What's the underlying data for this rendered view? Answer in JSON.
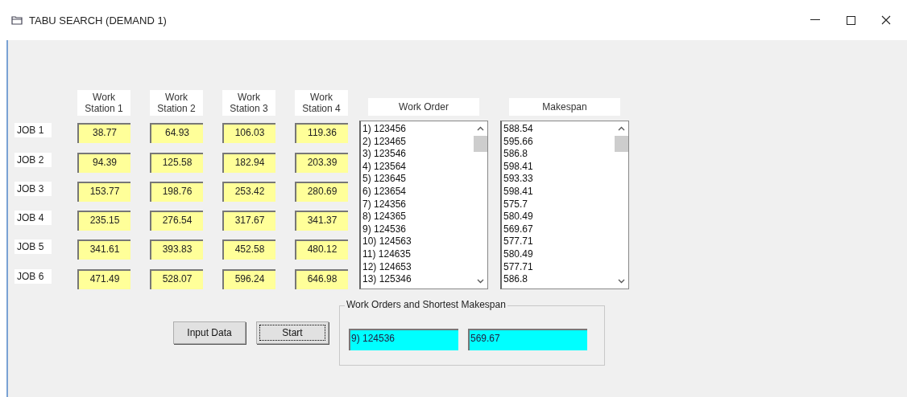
{
  "window": {
    "title": "TABU SEARCH (DEMAND 1)"
  },
  "columns": [
    "Work\nStation 1",
    "Work\nStation 2",
    "Work\nStation 3",
    "Work\nStation 4"
  ],
  "jobs": [
    {
      "label": "JOB 1",
      "values": [
        "38.77",
        "64.93",
        "106.03",
        "119.36"
      ]
    },
    {
      "label": "JOB 2",
      "values": [
        "94.39",
        "125.58",
        "182.94",
        "203.39"
      ]
    },
    {
      "label": "JOB 3",
      "values": [
        "153.77",
        "198.76",
        "253.42",
        "280.69"
      ]
    },
    {
      "label": "JOB 4",
      "values": [
        "235.15",
        "276.54",
        "317.67",
        "341.37"
      ]
    },
    {
      "label": "JOB 5",
      "values": [
        "341.61",
        "393.83",
        "452.58",
        "480.12"
      ]
    },
    {
      "label": "JOB 6",
      "values": [
        "471.49",
        "528.07",
        "596.24",
        "646.98"
      ]
    }
  ],
  "lists": [
    {
      "header": "Work Order",
      "items": [
        "1) 123456",
        "2) 123465",
        "3) 123546",
        "4) 123564",
        "5) 123645",
        "6) 123654",
        "7) 124356",
        "8) 124365",
        "9) 124536",
        "10) 124563",
        "11) 124635",
        "12) 124653",
        "13) 125346"
      ]
    },
    {
      "header": "Makespan",
      "items": [
        "588.54",
        "595.66",
        "586.8",
        "598.41",
        "593.33",
        "598.41",
        "575.7",
        "580.49",
        "569.67",
        "577.71",
        "580.49",
        "577.71",
        "586.8"
      ]
    }
  ],
  "buttons": [
    {
      "label": "Input Data",
      "focused": false
    },
    {
      "label": "Start",
      "focused": true
    }
  ],
  "result": {
    "title": "Work Orders and Shortest Makespan",
    "work_order": "9) 124536",
    "makespan": "569.67"
  }
}
